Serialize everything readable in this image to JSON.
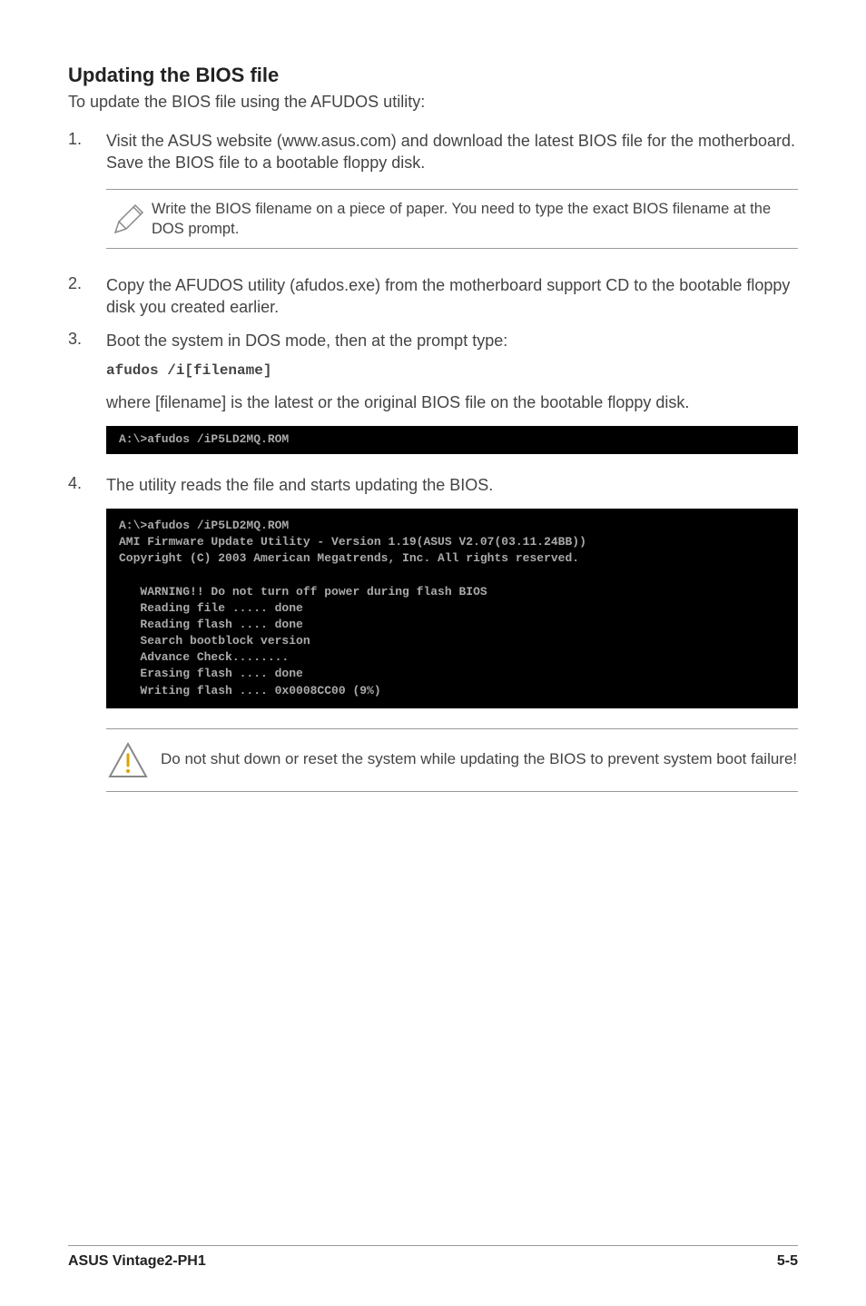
{
  "heading": "Updating the BIOS file",
  "intro": "To update the BIOS file using the AFUDOS utility:",
  "steps": {
    "s1_num": "1.",
    "s1_text": "Visit the ASUS website (www.asus.com) and download the latest BIOS file for the motherboard. Save the BIOS file to a bootable floppy disk.",
    "note_text": "Write the BIOS filename on a piece of paper. You need to type the exact BIOS filename at the DOS prompt.",
    "s2_num": "2.",
    "s2_text": "Copy the AFUDOS utility (afudos.exe) from the motherboard support CD to the bootable floppy disk you created earlier.",
    "s3_num": "3.",
    "s3_text": "Boot the system in DOS mode, then at the prompt type:",
    "s3_code": "afudos /i[filename]",
    "s3_followup": "where [filename] is the latest or the original BIOS file on the bootable floppy disk.",
    "terminal1": "A:\\>afudos /iP5LD2MQ.ROM",
    "s4_num": "4.",
    "s4_text": "The utility reads the file and starts updating the BIOS.",
    "terminal2": "A:\\>afudos /iP5LD2MQ.ROM\nAMI Firmware Update Utility - Version 1.19(ASUS V2.07(03.11.24BB))\nCopyright (C) 2003 American Megatrends, Inc. All rights reserved.\n\n   WARNING!! Do not turn off power during flash BIOS\n   Reading file ..... done\n   Reading flash .... done\n   Search bootblock version\n   Advance Check........\n   Erasing flash .... done\n   Writing flash .... 0x0008CC00 (9%)",
    "warn_text": "Do not shut down or reset the system while updating the BIOS to prevent system boot failure!"
  },
  "footer": {
    "left": "ASUS Vintage2-PH1",
    "right": "5-5"
  }
}
